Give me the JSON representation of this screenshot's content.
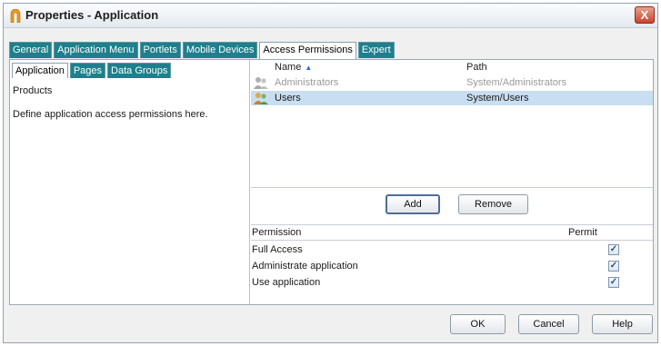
{
  "window": {
    "title": "Properties - Application",
    "close_glyph": "X"
  },
  "top_tabs": [
    {
      "label": "General",
      "active": false
    },
    {
      "label": "Application Menu",
      "active": false
    },
    {
      "label": "Portlets",
      "active": false
    },
    {
      "label": "Mobile Devices",
      "active": false
    },
    {
      "label": "Access Permissions",
      "active": true
    },
    {
      "label": "Expert",
      "active": false
    }
  ],
  "left_tabs": [
    {
      "label": "Application",
      "active": true
    },
    {
      "label": "Pages",
      "active": false
    },
    {
      "label": "Data Groups",
      "active": false
    }
  ],
  "left_pane": {
    "label": "Products",
    "description": "Define application access permissions here."
  },
  "list": {
    "col_name": "Name",
    "col_path": "Path",
    "sort_glyph": "▲",
    "rows": [
      {
        "name": "Administrators",
        "path": "System/Administrators",
        "selected": false,
        "dim": true,
        "icon": "group-icon"
      },
      {
        "name": "Users",
        "path": "System/Users",
        "selected": true,
        "dim": false,
        "icon": "group-icon"
      }
    ]
  },
  "buttons": {
    "add": "Add",
    "remove": "Remove",
    "ok": "OK",
    "cancel": "Cancel",
    "help": "Help"
  },
  "permissions": {
    "col_permission": "Permission",
    "col_permit": "Permit",
    "check_glyph": "✓",
    "rows": [
      {
        "label": "Full Access",
        "permit": true
      },
      {
        "label": "Administrate application",
        "permit": true
      },
      {
        "label": "Use application",
        "permit": true
      }
    ]
  },
  "colors": {
    "tab_bg": "#1f7f8c",
    "selection": "#c9def0",
    "title_icon": "#e89a1a"
  }
}
